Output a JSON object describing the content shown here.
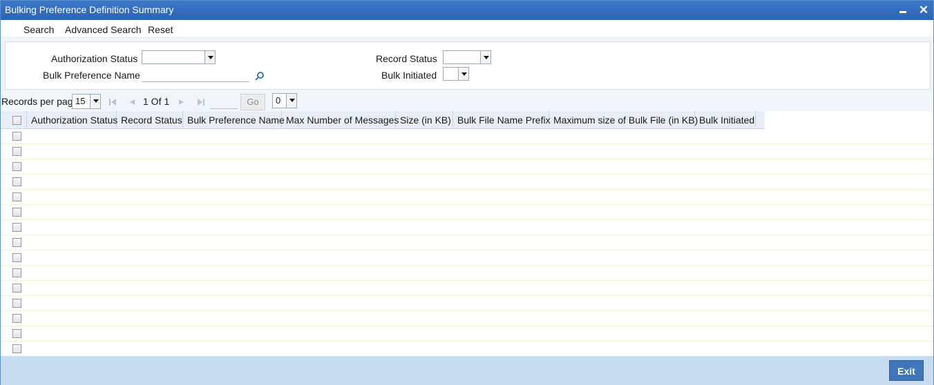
{
  "window": {
    "title": "Bulking Preference Definition Summary"
  },
  "toolbar": {
    "search": "Search",
    "advanced_search": "Advanced Search",
    "reset": "Reset"
  },
  "criteria": {
    "authorization_status_label": "Authorization Status",
    "authorization_status_value": "",
    "bulk_preference_name_label": "Bulk Preference Name",
    "bulk_preference_name_value": "",
    "record_status_label": "Record Status",
    "record_status_value": "",
    "bulk_initiated_label": "Bulk Initiated",
    "bulk_initiated_value": ""
  },
  "pager": {
    "records_per_page_label": "Records per page",
    "records_per_page_value": "15",
    "page_indicator": "1 Of 1",
    "go_label": "Go",
    "page_select_value": "0"
  },
  "grid": {
    "columns": [
      "Authorization Status",
      "Record Status",
      "Bulk Preference Name",
      "Max Number of Messages",
      "Size (in KB)",
      "Bulk File Name Prefix",
      "Maximum size of Bulk File (in KB)",
      "Bulk Initiated"
    ],
    "row_count": 15
  },
  "footer": {
    "exit_label": "Exit"
  },
  "colors": {
    "titlebar": "#2f6bbd",
    "header_bg": "#e7eef7",
    "footer_bg": "#c7dbf0",
    "exit_button": "#3e76b8"
  }
}
